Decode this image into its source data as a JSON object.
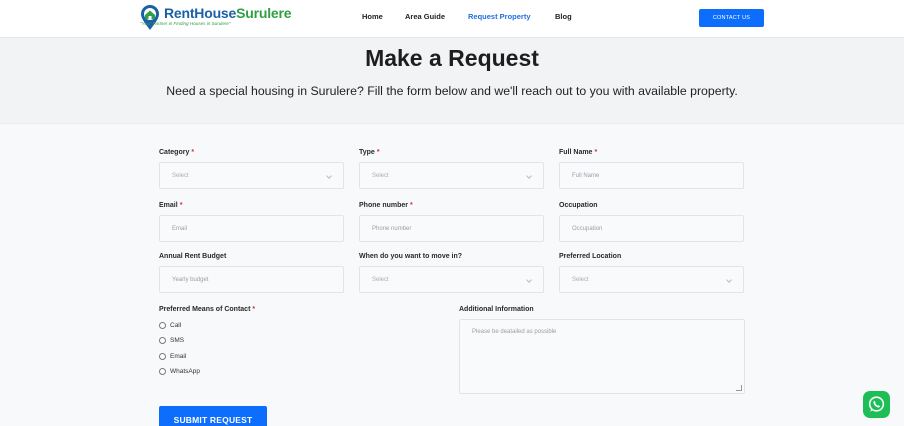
{
  "header": {
    "logo": {
      "name_part1": "RentHouse",
      "name_part2": "Surulere",
      "tagline": "\"Your Partner in Finding Houses in Surulere\""
    },
    "nav": [
      {
        "label": "Home",
        "active": false
      },
      {
        "label": "Area Guide",
        "active": false
      },
      {
        "label": "Request Property",
        "active": true
      },
      {
        "label": "Blog",
        "active": false
      }
    ],
    "contact_button": "CONTACT US"
  },
  "hero": {
    "title": "Make a Request",
    "subtitle": "Need a special housing in Surulere? Fill the form below and we'll reach out to you with available property."
  },
  "form": {
    "category": {
      "label": "Category",
      "required": "*",
      "value": "Select"
    },
    "type": {
      "label": "Type",
      "required": "*",
      "value": "Select"
    },
    "full_name": {
      "label": "Full Name",
      "required": "*",
      "placeholder": "Full Name"
    },
    "email": {
      "label": "Email",
      "required": "*",
      "placeholder": "Email"
    },
    "phone": {
      "label": "Phone number",
      "required": "*",
      "placeholder": "Phone number"
    },
    "occupation": {
      "label": "Occupation",
      "placeholder": "Occupation"
    },
    "budget": {
      "label": "Annual Rent Budget",
      "placeholder": "Yearly budget"
    },
    "move_in": {
      "label": "When do you want to move in?",
      "value": "Select"
    },
    "location": {
      "label": "Preferred Location",
      "value": "Select"
    },
    "contact_means": {
      "label": "Preferred Means of Contact",
      "required": "*",
      "options": [
        "Call",
        "SMS",
        "Email",
        "WhatsApp"
      ]
    },
    "additional": {
      "label": "Additional Information",
      "placeholder": "Please be deatailed as possible"
    },
    "submit": "SUBMIT REQUEST"
  },
  "colors": {
    "primary": "#0d6efd",
    "brand_blue": "#1a5fa8",
    "brand_green": "#2ea043",
    "required": "#d32f2f",
    "whatsapp": "#1ebe57"
  },
  "icons": {
    "logo": "house-pin-icon",
    "whatsapp": "whatsapp-icon"
  }
}
